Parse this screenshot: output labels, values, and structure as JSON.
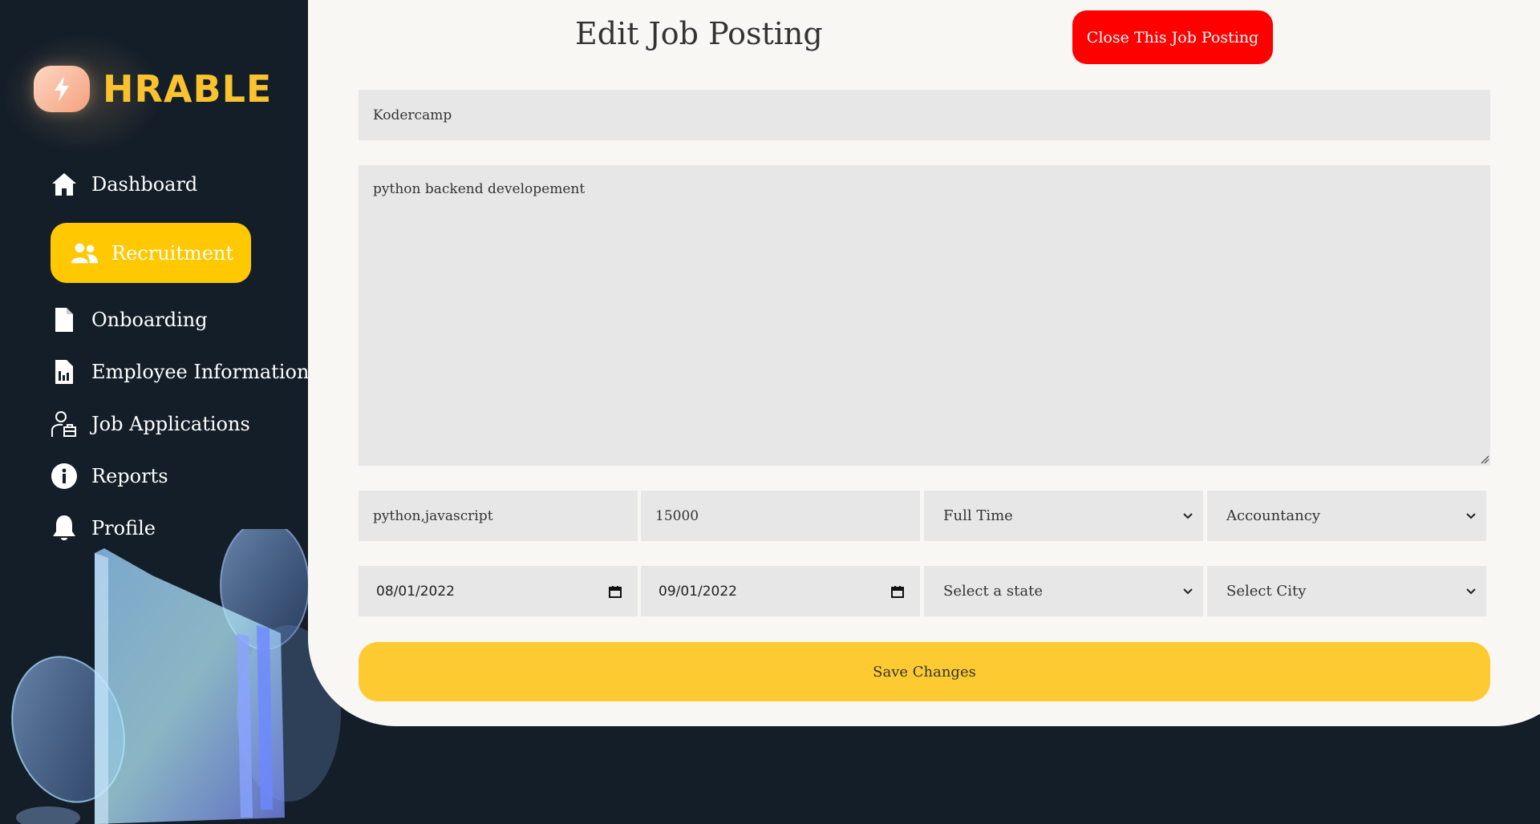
{
  "brand": {
    "name": "HRABLE",
    "logo_icon": "lightning-bolt-icon"
  },
  "sidebar": {
    "items": [
      {
        "label": "Dashboard",
        "icon": "home-icon",
        "active": false
      },
      {
        "label": "Recruitment",
        "icon": "users-icon",
        "active": true
      },
      {
        "label": "Onboarding",
        "icon": "file-icon",
        "active": false
      },
      {
        "label": "Employee Information",
        "icon": "report-file-icon",
        "active": false
      },
      {
        "label": "Job Applications",
        "icon": "user-briefcase-icon",
        "active": false
      },
      {
        "label": "Reports",
        "icon": "info-icon",
        "active": false
      },
      {
        "label": "Profile",
        "icon": "bell-icon",
        "active": false
      }
    ]
  },
  "form": {
    "title": "Edit Job Posting",
    "close_label": "Close This Job Posting",
    "company": "Kodercamp",
    "description": "python backend developement",
    "skills": "python,javascript",
    "salary": "15000",
    "job_type": "Full Time",
    "category": "Accountancy",
    "start_date": "08/01/2022",
    "end_date": "09/01/2022",
    "state": "Select a state",
    "city": "Select City",
    "save_label": "Save Changes"
  },
  "colors": {
    "background": "#141e29",
    "card": "#f8f7f4",
    "accent": "#ffc800",
    "danger": "#ff0000",
    "brand_text": "#f9c22e",
    "field": "#e7e7e7"
  }
}
